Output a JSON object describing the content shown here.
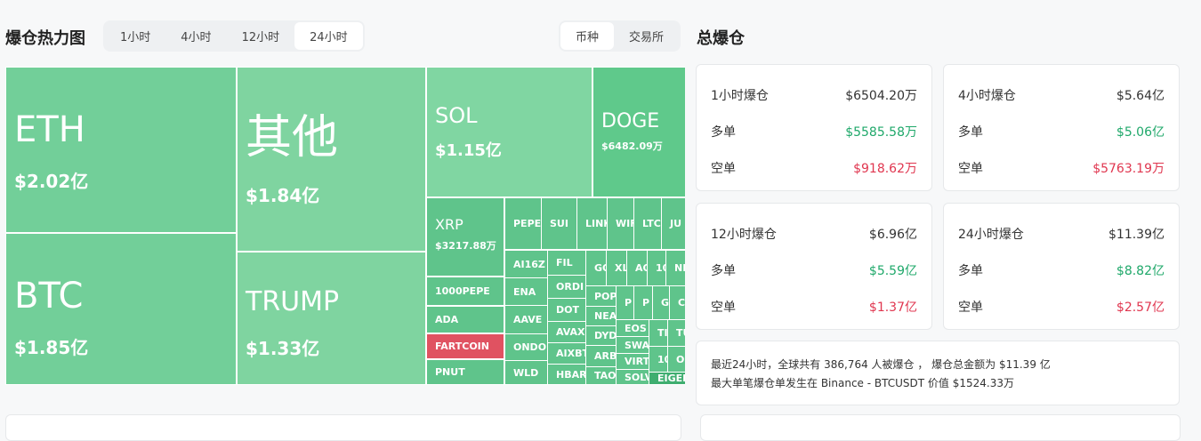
{
  "heatmap": {
    "title": "爆仓热力图",
    "time_tabs": [
      "1小时",
      "4小时",
      "12小时",
      "24小时"
    ],
    "active_time": "24小时",
    "group_tabs": [
      "币种",
      "交易所"
    ],
    "active_group": "币种",
    "tiles": [
      {
        "name": "ETH",
        "value": "$2.02亿"
      },
      {
        "name": "BTC",
        "value": "$1.85亿"
      },
      {
        "name": "其他",
        "value": "$1.84亿"
      },
      {
        "name": "TRUMP",
        "value": "$1.33亿"
      },
      {
        "name": "SOL",
        "value": "$1.15亿"
      },
      {
        "name": "DOGE",
        "value": "$6482.09万"
      },
      {
        "name": "XRP",
        "value": "$3217.88万"
      },
      {
        "name": "1000PEPE"
      },
      {
        "name": "ADA"
      },
      {
        "name": "FARTCOIN"
      },
      {
        "name": "PNUT"
      },
      {
        "name": "PEPE"
      },
      {
        "name": "SUI"
      },
      {
        "name": "LINK"
      },
      {
        "name": "WIF"
      },
      {
        "name": "LTC"
      },
      {
        "name": "JU"
      },
      {
        "name": "AI16Z"
      },
      {
        "name": "ENA"
      },
      {
        "name": "AAVE"
      },
      {
        "name": "ONDO"
      },
      {
        "name": "WLD"
      },
      {
        "name": "FIL"
      },
      {
        "name": "ORDI"
      },
      {
        "name": "DOT"
      },
      {
        "name": "AVAX"
      },
      {
        "name": "AIXBT"
      },
      {
        "name": "HBAR"
      },
      {
        "name": "GO"
      },
      {
        "name": "XL"
      },
      {
        "name": "AO"
      },
      {
        "name": "10"
      },
      {
        "name": "NE"
      },
      {
        "name": "POP"
      },
      {
        "name": "NEA"
      },
      {
        "name": "DYD"
      },
      {
        "name": "ARB"
      },
      {
        "name": "TAO"
      },
      {
        "name": "P"
      },
      {
        "name": "P"
      },
      {
        "name": "G"
      },
      {
        "name": "C"
      },
      {
        "name": "EOS"
      },
      {
        "name": "SWA"
      },
      {
        "name": "VIRT"
      },
      {
        "name": "SOLV"
      },
      {
        "name": "TI"
      },
      {
        "name": "TU"
      },
      {
        "name": "10"
      },
      {
        "name": "O"
      },
      {
        "name": "EIGEN"
      }
    ],
    "colors": {
      "long": "#5fc48b",
      "light": "#7fd4a0",
      "short": "#e05261",
      "dark": "#3fae70"
    }
  },
  "summary": {
    "title": "总爆仓",
    "long_label": "多单",
    "short_label": "空单",
    "cards": [
      {
        "label": "1小时爆仓",
        "total": "$6504.20万",
        "long": "$5585.58万",
        "short": "$918.62万"
      },
      {
        "label": "4小时爆仓",
        "total": "$5.64亿",
        "long": "$5.06亿",
        "short": "$5763.19万"
      },
      {
        "label": "12小时爆仓",
        "total": "$6.96亿",
        "long": "$5.59亿",
        "short": "$1.37亿"
      },
      {
        "label": "24小时爆仓",
        "total": "$11.39亿",
        "long": "$8.82亿",
        "short": "$2.57亿"
      }
    ],
    "info_line1": "最近24小时，全球共有 386,764 人被爆仓 ， 爆仓总金额为 $11.39 亿",
    "info_line2": "最大单笔爆仓单发生在 Binance - BTCUSDT 价值 $1524.33万"
  }
}
